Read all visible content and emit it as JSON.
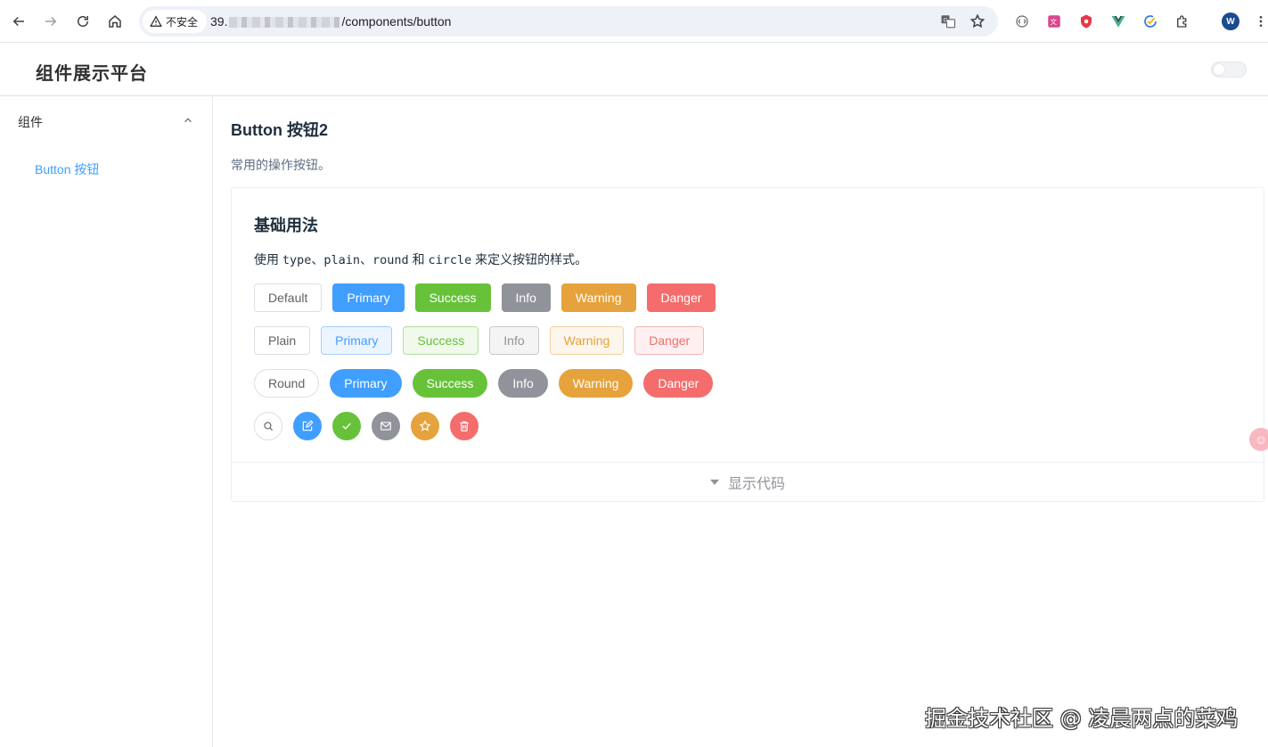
{
  "browser": {
    "security_label": "不安全",
    "url_prefix": "39.",
    "url_path": "/components/button",
    "profile_initial": "W"
  },
  "app": {
    "title": "组件展示平台"
  },
  "sidebar": {
    "group_label": "组件",
    "items": [
      {
        "label": "Button 按钮",
        "active": true
      }
    ]
  },
  "page": {
    "title": "Button 按钮2",
    "description": "常用的操作按钮。"
  },
  "demo": {
    "title": "基础用法",
    "desc_pre": "使用 ",
    "desc_code1": "type",
    "desc_sep1": "、",
    "desc_code2": "plain",
    "desc_sep2": "、",
    "desc_code3": "round",
    "desc_and": " 和 ",
    "desc_code4": "circle",
    "desc_post": " 来定义按钮的样式。",
    "rows": {
      "default": [
        "Default",
        "Primary",
        "Success",
        "Info",
        "Warning",
        "Danger"
      ],
      "plain": [
        "Plain",
        "Primary",
        "Success",
        "Info",
        "Warning",
        "Danger"
      ],
      "round": [
        "Round",
        "Primary",
        "Success",
        "Info",
        "Warning",
        "Danger"
      ]
    },
    "circle_icons": [
      "search-icon",
      "edit-icon",
      "check-icon",
      "message-icon",
      "star-icon",
      "delete-icon"
    ],
    "show_code_label": "显示代码"
  },
  "colors": {
    "primary": "#409eff",
    "success": "#67c23a",
    "info": "#909399",
    "warning": "#e6a23c",
    "danger": "#f56c6c"
  },
  "watermark": "掘金技术社区 @ 凌晨两点的菜鸡"
}
